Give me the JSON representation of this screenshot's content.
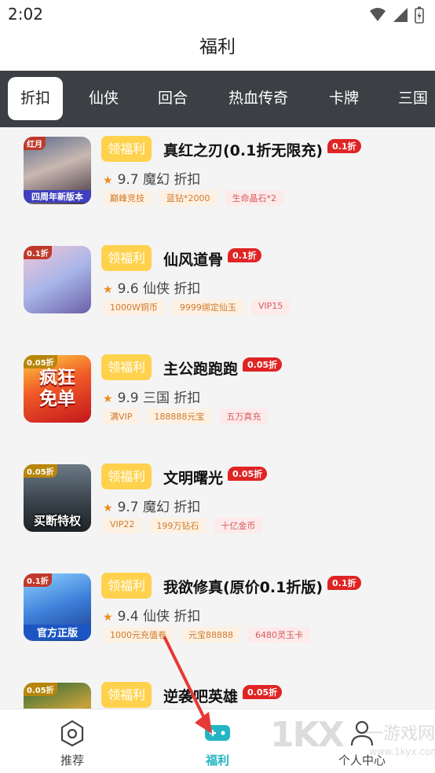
{
  "status_bar": {
    "time": "2:02"
  },
  "header": {
    "title": "福利"
  },
  "tabs": [
    {
      "label": "折扣",
      "active": true
    },
    {
      "label": "仙侠",
      "active": false
    },
    {
      "label": "回合",
      "active": false
    },
    {
      "label": "热血传奇",
      "active": false
    },
    {
      "label": "卡牌",
      "active": false
    },
    {
      "label": "三国",
      "active": false
    }
  ],
  "games": [
    {
      "welfare_label": "领福利",
      "name": "真红之刃(0.1折无限充)",
      "discount": "0.1折",
      "rating": "9.7",
      "genre": "魔幻",
      "type": "折扣",
      "tags": [
        "巅峰竞技",
        "蓝钻*2000",
        "生命晶石*2"
      ],
      "icon": {
        "badge": "红月",
        "caption": "四周年新版本",
        "big": ""
      }
    },
    {
      "welfare_label": "领福利",
      "name": "仙风道骨",
      "discount": "0.1折",
      "rating": "9.6",
      "genre": "仙侠",
      "type": "折扣",
      "tags": [
        "1000W铜币",
        "9999绑定仙玉",
        "VIP15"
      ],
      "icon": {
        "badge": "0.1折",
        "caption": "",
        "big": ""
      }
    },
    {
      "welfare_label": "领福利",
      "name": "主公跑跑跑",
      "discount": "0.05折",
      "rating": "9.9",
      "genre": "三国",
      "type": "折扣",
      "tags": [
        "满VIP",
        "188888元宝",
        "五万真充"
      ],
      "icon": {
        "badge": "0.05折",
        "caption": "",
        "big": "疯狂\n免单"
      }
    },
    {
      "welfare_label": "领福利",
      "name": "文明曙光",
      "discount": "0.05折",
      "rating": "9.7",
      "genre": "魔幻",
      "type": "折扣",
      "tags": [
        "VIP22",
        "199万钻石",
        "十亿金币"
      ],
      "icon": {
        "badge": "0.05折",
        "caption": "买断特权",
        "big": ""
      }
    },
    {
      "welfare_label": "领福利",
      "name": "我欲修真(原价0.1折版)",
      "discount": "0.1折",
      "rating": "9.4",
      "genre": "仙侠",
      "type": "折扣",
      "tags": [
        "1000元充值卷",
        "元宝88888",
        "6480灵玉卡"
      ],
      "icon": {
        "badge": "0.1折",
        "caption": "官方正版",
        "big": ""
      }
    },
    {
      "welfare_label": "领福利",
      "name": "逆袭吧英雄",
      "discount": "0.05折",
      "rating": "",
      "genre": "",
      "type": "",
      "tags": [],
      "icon": {
        "badge": "0.05折",
        "caption": "",
        "big": ""
      }
    }
  ],
  "bottom_nav": [
    {
      "label": "推荐",
      "icon": "home-icon",
      "active": false
    },
    {
      "label": "福利",
      "icon": "gamepad-icon",
      "active": true
    },
    {
      "label": "个人中心",
      "icon": "user-icon",
      "active": false
    }
  ],
  "watermark": {
    "brand": "1KX",
    "text": "一游戏网",
    "url": "www.1kyx.com"
  },
  "colors": {
    "accent": "#23b5c3",
    "tab_bar": "#3c3f44",
    "welfare_button": "#ffd24d",
    "discount_badge": "#e02424",
    "star": "#f08a1c",
    "annotation_arrow": "#e53935"
  }
}
